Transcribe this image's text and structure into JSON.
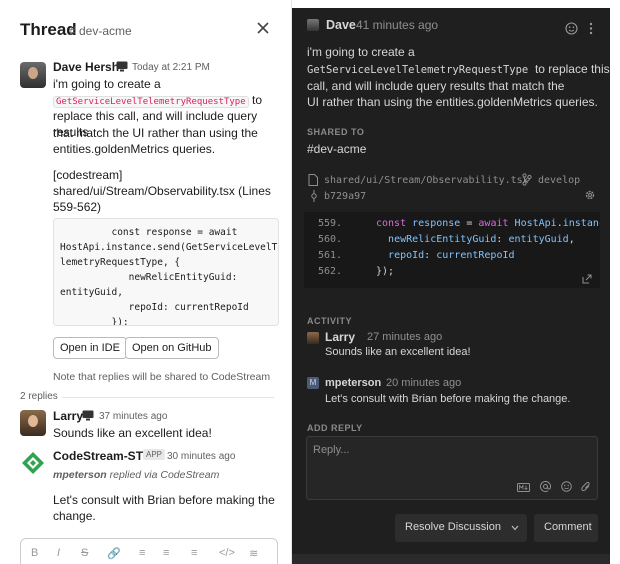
{
  "left": {
    "header": {
      "title": "Thread",
      "channel": "# dev-acme"
    },
    "root_message": {
      "author": "Dave Hersh",
      "author_icon": "computer-icon",
      "time": "Today at 2:21 PM",
      "line1": "i'm going to create a",
      "code": "GetServiceLevelTelemetryRequestType",
      "line2_after": "to",
      "line3": "replace this call, and will include query results",
      "line4": "that match the UI rather than using the",
      "line5": "entities.goldenMetrics queries.",
      "file_ref_1": "[codestream]",
      "file_ref_2": "shared/ui/Stream/Observability.tsx (Lines",
      "file_ref_3": "559-562)",
      "code_block": "         const response = await\nHostApi.instance.send(GetServiceLevelTe\nlemetryRequestType, {\n            newRelicEntityGuid:\nentityGuid,\n            repoId: currentRepoId\n         });",
      "btn_open_ide": "Open in IDE",
      "btn_open_github": "Open on GitHub",
      "note": "Note that replies will be shared to CodeStream"
    },
    "replies_count": "2 replies",
    "reply1": {
      "author": "Larry",
      "author_icon": "computer-icon",
      "time": "37 minutes ago",
      "text": "Sounds like an excellent idea!"
    },
    "reply2": {
      "author": "CodeStream-STG",
      "badge": "APP",
      "time": "30 minutes ago",
      "via": "mpeterson replied via CodeStream",
      "via_user": "mpeterson",
      "via_rest": " replied via CodeStream",
      "text1": "Let's consult with Brian before making the",
      "text2": "change."
    },
    "composer_toolbar": [
      "B",
      "I",
      "S",
      "🔗",
      "≡",
      "≡",
      "≡",
      "</>",
      "≋"
    ]
  },
  "right": {
    "author": "Dave",
    "time": "41 minutes ago",
    "line1": "i'm going to create a",
    "code": "GetServiceLevelTelemetryRequestType",
    "code_after": "to replace this",
    "line3": "call, and will include query results that match the",
    "line4": "UI rather than using the entities.goldenMetrics queries.",
    "shared_to_label": "SHARED TO",
    "shared_to": "#dev-acme",
    "file_path": "shared/ui/Stream/Observability.tsx",
    "branch": "develop",
    "commit": "b729a97",
    "snippet": {
      "lines": [
        "559.",
        "560.",
        "561.",
        "562."
      ]
    },
    "activity_label": "ACTIVITY",
    "activity": [
      {
        "author": "Larry",
        "time": "27 minutes ago",
        "text": "Sounds like an excellent idea!"
      },
      {
        "author": "mpeterson",
        "avatar_letter": "M",
        "time": "20 minutes ago",
        "text": "Let's consult with Brian before making the change."
      }
    ],
    "add_reply_label": "ADD REPLY",
    "reply_placeholder": "Reply...",
    "btn_resolve": "Resolve Discussion",
    "btn_comment": "Comment"
  },
  "colors": {
    "accent_code": "#e01e5a",
    "dark_bg": "#1f1f1f",
    "keyword": "#d96ad8",
    "variable": "#7ec3ff",
    "function": "#e8e06d"
  }
}
